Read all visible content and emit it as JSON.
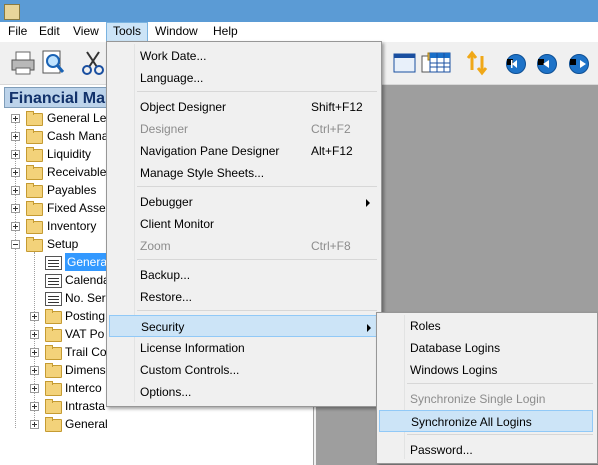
{
  "menubar": [
    "File",
    "Edit",
    "View",
    "Tools",
    "Window",
    "Help"
  ],
  "navpane": {
    "title": "Financial Ma",
    "items": [
      {
        "label": "General Le",
        "type": "folder"
      },
      {
        "label": "Cash Mana",
        "type": "folder"
      },
      {
        "label": "Liquidity",
        "type": "folder"
      },
      {
        "label": "Receivables",
        "type": "folder"
      },
      {
        "label": "Payables",
        "type": "folder"
      },
      {
        "label": "Fixed Asset",
        "type": "folder"
      },
      {
        "label": "Inventory",
        "type": "folder"
      },
      {
        "label": "Setup",
        "type": "folder"
      },
      {
        "label": "General",
        "type": "page",
        "selected": true
      },
      {
        "label": "Calenda",
        "type": "page"
      },
      {
        "label": "No. Ser",
        "type": "page"
      },
      {
        "label": "Posting",
        "type": "folder"
      },
      {
        "label": "VAT Po",
        "type": "folder"
      },
      {
        "label": "Trail Co",
        "type": "folder"
      },
      {
        "label": "Dimens",
        "type": "folder"
      },
      {
        "label": "Interco",
        "type": "folder"
      },
      {
        "label": "Intrasta",
        "type": "folder"
      },
      {
        "label": "General",
        "type": "folder"
      }
    ]
  },
  "tools_menu": {
    "items": [
      {
        "label": "Work Date...",
        "shortcut": ""
      },
      {
        "label": "Language...",
        "shortcut": ""
      },
      {
        "label": "Object Designer",
        "shortcut": "Shift+F12"
      },
      {
        "label": "Designer",
        "shortcut": "Ctrl+F2",
        "disabled": true
      },
      {
        "label": "Navigation Pane Designer",
        "shortcut": "Alt+F12"
      },
      {
        "label": "Manage Style Sheets...",
        "shortcut": ""
      },
      {
        "label": "Debugger",
        "shortcut": "",
        "submenu": true
      },
      {
        "label": "Client Monitor",
        "shortcut": ""
      },
      {
        "label": "Zoom",
        "shortcut": "Ctrl+F8",
        "disabled": true
      },
      {
        "label": "Backup...",
        "shortcut": ""
      },
      {
        "label": "Restore...",
        "shortcut": ""
      },
      {
        "label": "Security",
        "shortcut": "",
        "submenu": true,
        "highlighted": true
      },
      {
        "label": "License Information",
        "shortcut": ""
      },
      {
        "label": "Custom Controls...",
        "shortcut": ""
      },
      {
        "label": "Options...",
        "shortcut": ""
      }
    ]
  },
  "security_submenu": {
    "items": [
      {
        "label": "Roles"
      },
      {
        "label": "Database Logins"
      },
      {
        "label": "Windows Logins"
      },
      {
        "label": "Synchronize Single Login",
        "disabled": true
      },
      {
        "label": "Synchronize All Logins",
        "highlighted": true
      },
      {
        "label": "Password..."
      }
    ]
  }
}
